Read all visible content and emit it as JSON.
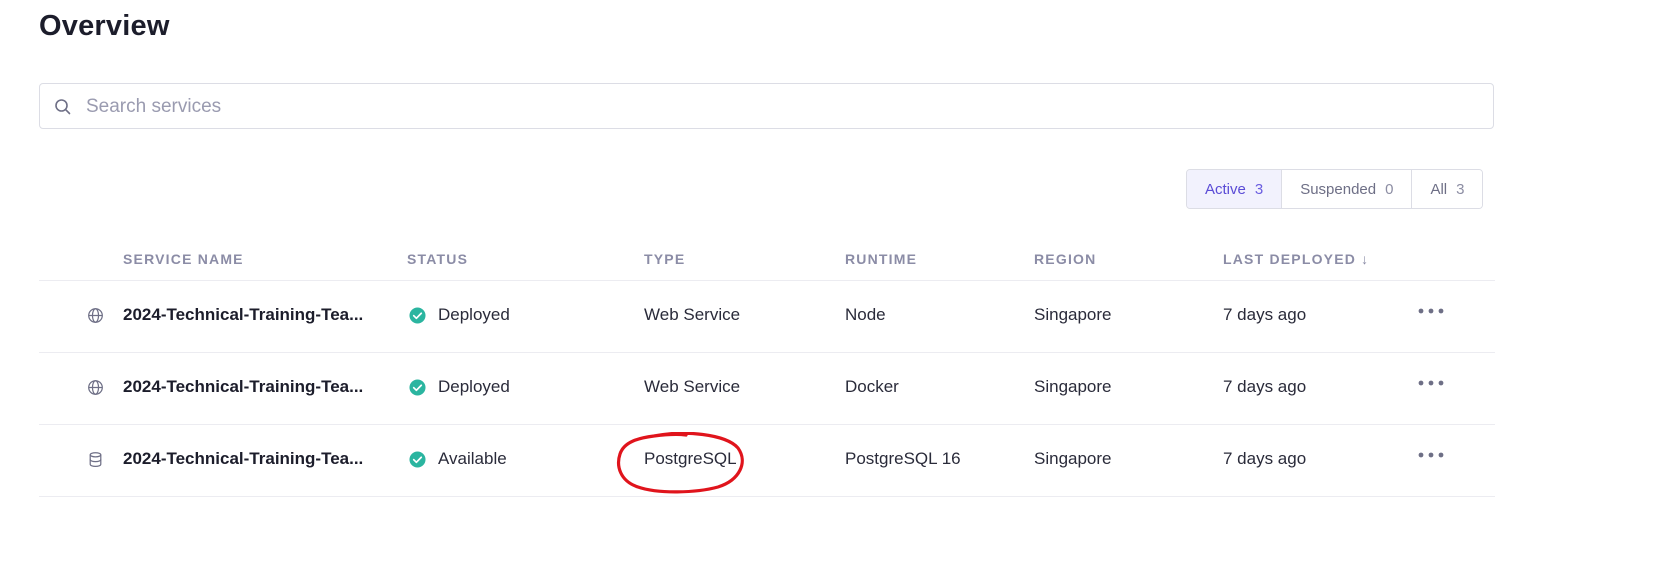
{
  "page": {
    "title": "Overview"
  },
  "search": {
    "placeholder": "Search services",
    "value": ""
  },
  "filters": [
    {
      "label": "Active",
      "count": "3",
      "active": true
    },
    {
      "label": "Suspended",
      "count": "0",
      "active": false
    },
    {
      "label": "All",
      "count": "3",
      "active": false
    }
  ],
  "table": {
    "headers": {
      "service_name": "SERVICE NAME",
      "status": "STATUS",
      "type": "TYPE",
      "runtime": "RUNTIME",
      "region": "REGION",
      "last_deployed": "LAST DEPLOYED ↓"
    },
    "rows": [
      {
        "icon": "globe-icon",
        "name": "2024-Technical-Training-Tea...",
        "status": "Deployed",
        "type": "Web Service",
        "runtime": "Node",
        "region": "Singapore",
        "last_deployed": "7 days ago"
      },
      {
        "icon": "globe-icon",
        "name": "2024-Technical-Training-Tea...",
        "status": "Deployed",
        "type": "Web Service",
        "runtime": "Docker",
        "region": "Singapore",
        "last_deployed": "7 days ago"
      },
      {
        "icon": "database-icon",
        "name": "2024-Technical-Training-Tea...",
        "status": "Available",
        "type": "PostgreSQL",
        "runtime": "PostgreSQL 16",
        "region": "Singapore",
        "last_deployed": "7 days ago"
      }
    ]
  },
  "colors": {
    "accent": "#5a4bd6",
    "status_ok": "#2bb5a0",
    "annotation": "#e0141c"
  }
}
